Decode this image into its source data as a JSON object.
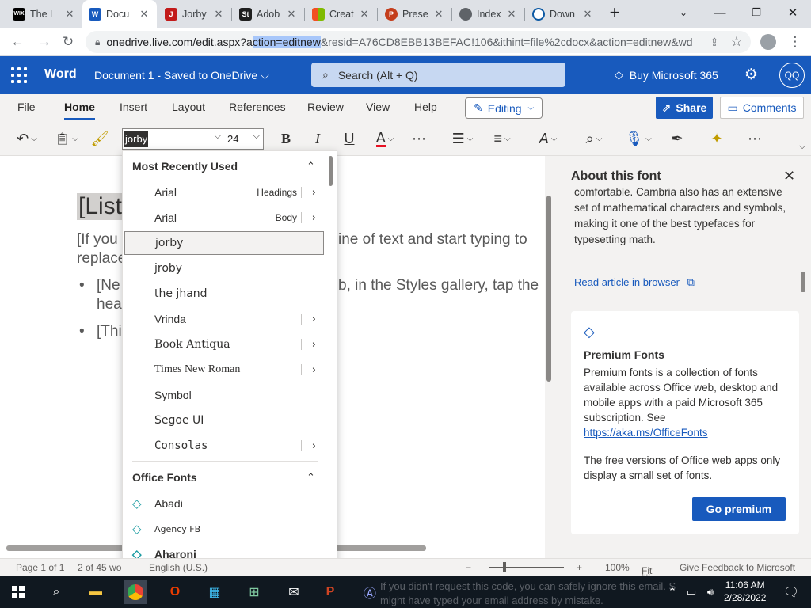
{
  "browser": {
    "tabs": [
      {
        "title": "The L",
        "favicon": "WIX",
        "color": "#000000"
      },
      {
        "title": "Docu",
        "favicon": "W",
        "color": "#185abd",
        "active": true
      },
      {
        "title": "Jorby",
        "favicon": "J",
        "color": "#c21a1a"
      },
      {
        "title": "Adob",
        "favicon": "St",
        "color": "#1f1f1f"
      },
      {
        "title": "Creat",
        "favicon": "MS",
        "color": "#f25022"
      },
      {
        "title": "Prese",
        "favicon": "P",
        "color": "#c43e1c"
      },
      {
        "title": "Index",
        "favicon": "globe",
        "color": "#5f6368"
      },
      {
        "title": "Down",
        "favicon": "edge",
        "color": "#0c59a4"
      }
    ],
    "url_host": "onedrive.live.com/edit.aspx?a",
    "url_selected": "ction=editnew",
    "url_rest": "&resid=A76CD8EBB13BEFAC!106&ithint=file%2cdocx&action=editnew&wd"
  },
  "word": {
    "app_name": "Word",
    "doc_title": "Document 1  -  Saved to OneDrive ⌵",
    "search_placeholder": "Search (Alt + Q)",
    "buy": "Buy Microsoft 365",
    "avatar": "QQ"
  },
  "ribbon": {
    "tabs": [
      "File",
      "Home",
      "Insert",
      "Layout",
      "References",
      "Review",
      "View",
      "Help"
    ],
    "editing": "Editing",
    "share": "Share",
    "comments": "Comments"
  },
  "toolbar": {
    "font_value": "jorby",
    "size_value": "24"
  },
  "document": {
    "heading": "[List",
    "para_a": "[If you",
    "para_b": "ine of text and start typing to",
    "para_c": "replace",
    "bullet1_a": "[Ne",
    "bullet1_b": "b, in the Styles gallery, tap the",
    "bullet1_c": "hea",
    "bullet2": "[Thi"
  },
  "font_dropdown": {
    "recent_header": "Most Recently Used",
    "recent": [
      {
        "name": "Arial",
        "hint": "Headings",
        "arrow": true
      },
      {
        "name": "Arial",
        "hint": "Body",
        "arrow": true
      },
      {
        "name": "jorby",
        "hint": "",
        "arrow": false,
        "selected": true
      },
      {
        "name": "jroby",
        "hint": "",
        "arrow": false
      },
      {
        "name": "the jhand",
        "hint": "",
        "arrow": false
      },
      {
        "name": "Vrinda",
        "hint": "",
        "arrow": true
      },
      {
        "name": "Book Antiqua",
        "hint": "",
        "arrow": true
      },
      {
        "name": "Times New Roman",
        "hint": "",
        "arrow": true
      },
      {
        "name": "Symbol",
        "hint": "",
        "arrow": false
      },
      {
        "name": "Segoe UI",
        "hint": "",
        "arrow": false
      },
      {
        "name": "Consolas",
        "hint": "",
        "arrow": true
      }
    ],
    "office_header": "Office Fonts",
    "office": [
      "Abadi",
      "Agency FB",
      "Aharoni"
    ]
  },
  "about_panel": {
    "title": "About this font",
    "text": "comfortable. Cambria also has an extensive set of mathematical characters and symbols, making it one of the best typefaces for typesetting math.",
    "read_article": "Read article in browser",
    "premium_title": "Premium Fonts",
    "premium_body": "Premium fonts is a collection of fonts available across Office web, desktop and mobile apps with a paid Microsoft 365 subscription. See ",
    "premium_link": "https://aka.ms/OfficeFonts",
    "premium_body2": "The free versions of Office web apps only display a small set of fonts.",
    "premium_button": "Go premium"
  },
  "status": {
    "page": "Page 1 of 1",
    "words": "2 of 45 wo",
    "language": "English (U.S.)",
    "zoom": "100%",
    "fit": "Fit",
    "feedback": "Give Feedback to Microsoft"
  },
  "taskbar": {
    "notice_line1": "If you didn't request this code, you can safely ignore this email. S",
    "notice_line2": "might have typed your email address by mistake.",
    "time": "11:06 AM",
    "date": "2/28/2022"
  }
}
